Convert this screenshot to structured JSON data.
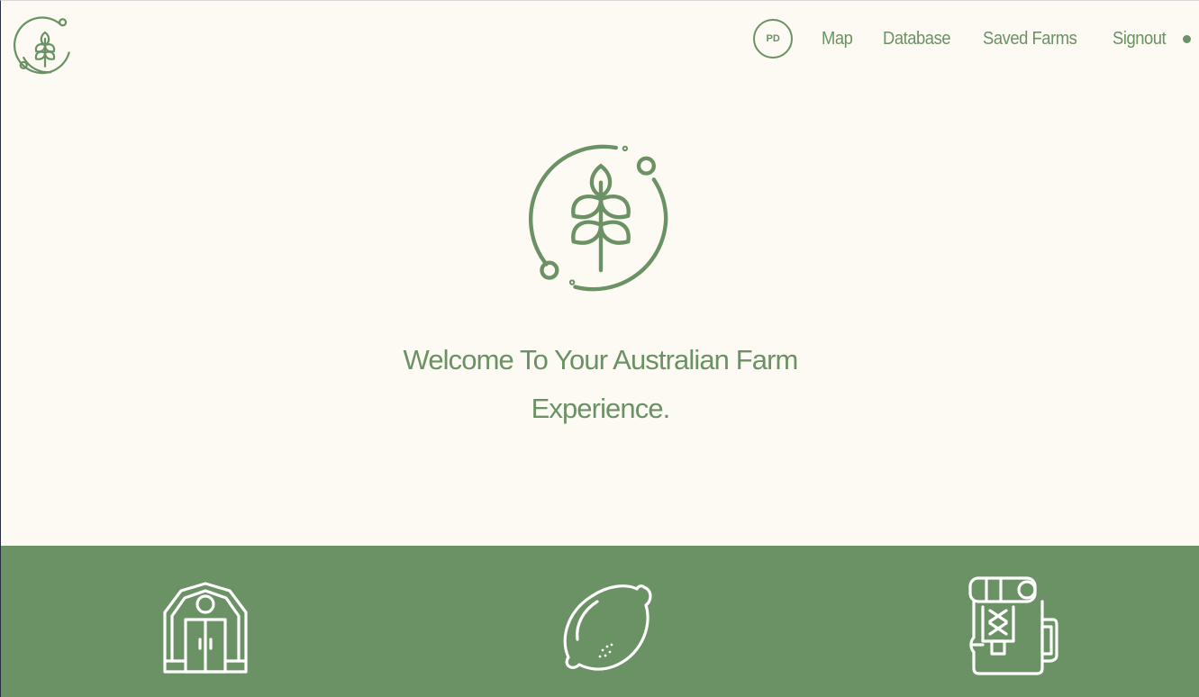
{
  "header": {
    "logo_icon": "wheat-logo-icon",
    "avatar_initials": "PD",
    "nav": [
      {
        "label": "Map"
      },
      {
        "label": "Database"
      },
      {
        "label": "Saved Farms"
      },
      {
        "label": "Signout"
      }
    ],
    "status_dot": "status-indicator"
  },
  "hero": {
    "logo_icon": "wheat-logo-icon",
    "welcome_line1": "Welcome To Your Australian Farm",
    "welcome_line2": "Experience."
  },
  "features": {
    "icons": [
      "barn-icon",
      "lemon-icon",
      "backpack-icon"
    ]
  },
  "colors": {
    "background": "#fdfaf3",
    "accent_green": "#6b9264",
    "band_icon": "#ffffff"
  }
}
